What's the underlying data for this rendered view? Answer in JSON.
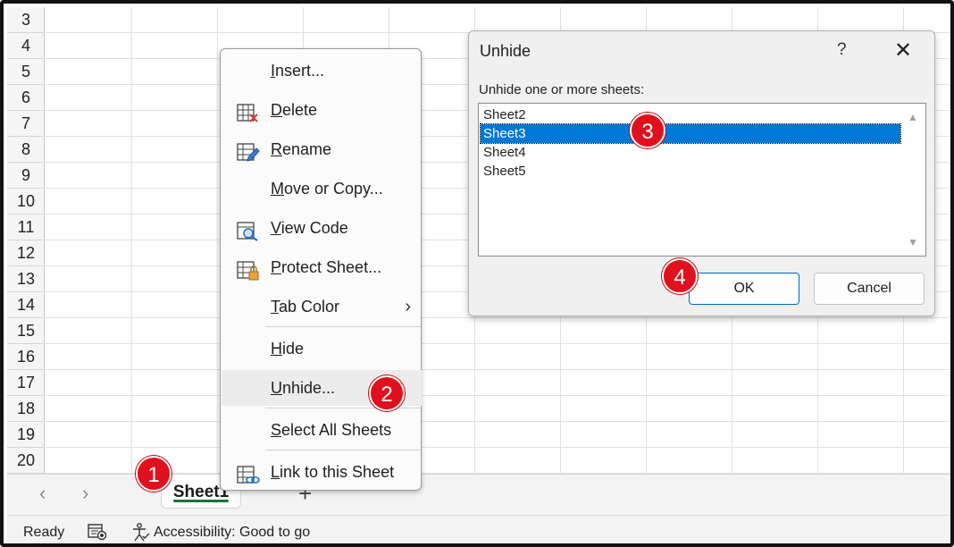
{
  "rows": [
    "3",
    "4",
    "5",
    "6",
    "7",
    "8",
    "9",
    "10",
    "11",
    "12",
    "13",
    "14",
    "15",
    "16",
    "17",
    "18",
    "19",
    "20"
  ],
  "tabbar": {
    "prev": "‹",
    "next": "›",
    "sheet_tab": "Sheet1",
    "add": "+"
  },
  "statusbar": {
    "ready": "Ready",
    "accessibility": "Accessibility: Good to go",
    "icons": [
      "macro-record-icon",
      "accessibility-icon"
    ]
  },
  "context_menu": {
    "items": [
      {
        "label": "Insert...",
        "icon": "none"
      },
      {
        "label": "Delete",
        "icon": "delete-sheet-icon"
      },
      {
        "label": "Rename",
        "icon": "rename-sheet-icon"
      },
      {
        "label": "Move or Copy...",
        "icon": "none"
      },
      {
        "label": "View Code",
        "icon": "view-code-icon"
      },
      {
        "label": "Protect Sheet...",
        "icon": "protect-sheet-icon"
      },
      {
        "label": "Tab Color",
        "icon": "none",
        "submenu": "›"
      },
      {
        "label": "Hide",
        "icon": "none"
      },
      {
        "label": "Unhide...",
        "icon": "none",
        "highlighted": true
      },
      {
        "label": "Select All Sheets",
        "icon": "none"
      },
      {
        "label": "Link to this Sheet",
        "icon": "link-sheet-icon"
      }
    ]
  },
  "dialog": {
    "title": "Unhide",
    "help": "?",
    "close": "✕",
    "label": "Unhide one or more sheets:",
    "sheets": [
      "Sheet2",
      "Sheet3",
      "Sheet4",
      "Sheet5"
    ],
    "selected": "Sheet3",
    "ok_label": "OK",
    "cancel_label": "Cancel",
    "scroll_up": "▲",
    "scroll_down": "▼"
  },
  "markers": [
    "1",
    "2",
    "3",
    "4"
  ],
  "colors": {
    "accent_green": "#1d6f42",
    "selection_blue": "#0078d7",
    "marker_red": "#e0101e"
  }
}
